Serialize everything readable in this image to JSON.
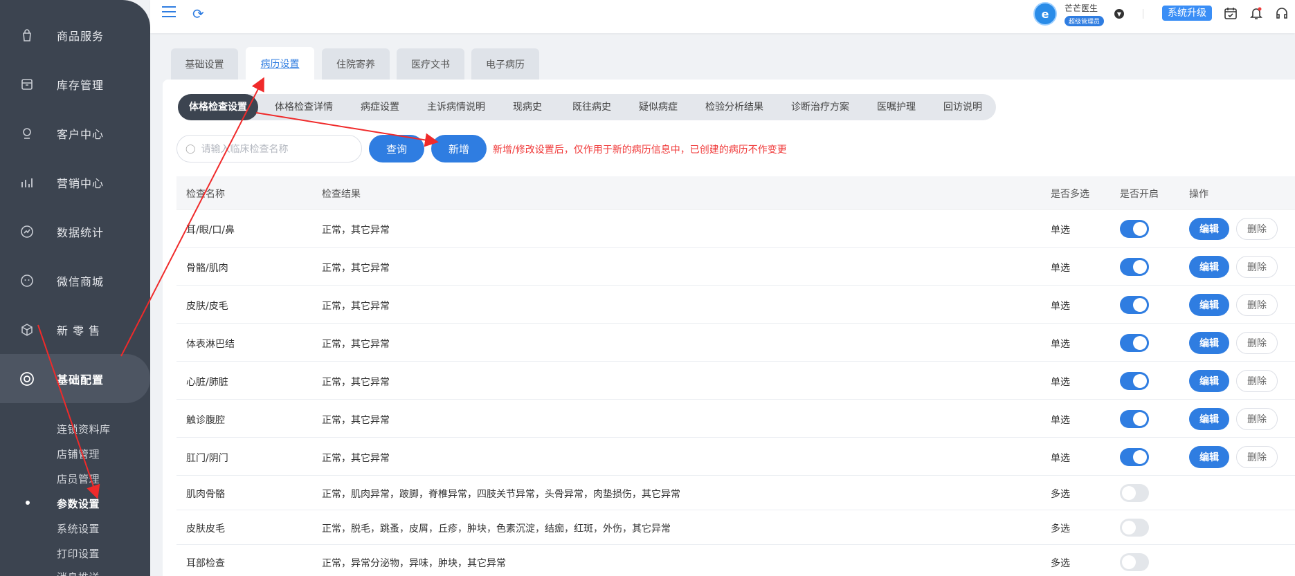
{
  "sidebar": {
    "items": [
      {
        "label": "商品服务",
        "icon": "bag-icon"
      },
      {
        "label": "库存管理",
        "icon": "box-icon"
      },
      {
        "label": "客户中心",
        "icon": "user-icon"
      },
      {
        "label": "营销中心",
        "icon": "chart-icon"
      },
      {
        "label": "数据统计",
        "icon": "stats-icon"
      },
      {
        "label": "微信商城",
        "icon": "wechat-icon"
      },
      {
        "label": "新 零 售",
        "icon": "cube-icon"
      },
      {
        "label": "基础配置",
        "icon": "target-icon"
      }
    ],
    "sub_items": [
      "连锁资料库",
      "店铺管理",
      "店员管理",
      "参数设置",
      "系统设置",
      "打印设置",
      "消息推送"
    ]
  },
  "header": {
    "user_name": "芒芒医生",
    "user_role": "超级管理员",
    "avatar_text": "e",
    "upgrade_label": "系统升级"
  },
  "top_tabs": [
    "基础设置",
    "病历设置",
    "住院寄养",
    "医疗文书",
    "电子病历"
  ],
  "sub_tabs": [
    "体格检查设置",
    "体格检查详情",
    "病症设置",
    "主诉病情说明",
    "现病史",
    "既往病史",
    "疑似病症",
    "检验分析结果",
    "诊断治疗方案",
    "医嘱护理",
    "回访说明"
  ],
  "search": {
    "placeholder": "请输入临床检查名称"
  },
  "buttons": {
    "query": "查询",
    "add": "新增",
    "edit": "编辑",
    "delete": "删除"
  },
  "notice": "新增/修改设置后，仅作用于新的病历信息中，已创建的病历不作变更",
  "table": {
    "headers": [
      "检查名称",
      "检查结果",
      "是否多选",
      "是否开启",
      "操作"
    ],
    "rows": [
      {
        "name": "耳/眼/口/鼻",
        "result": "正常，其它异常",
        "multi": "单选",
        "enabled": true,
        "actions": true
      },
      {
        "name": "骨骼/肌肉",
        "result": "正常，其它异常",
        "multi": "单选",
        "enabled": true,
        "actions": true
      },
      {
        "name": "皮肤/皮毛",
        "result": "正常，其它异常",
        "multi": "单选",
        "enabled": true,
        "actions": true
      },
      {
        "name": "体表淋巴结",
        "result": "正常，其它异常",
        "multi": "单选",
        "enabled": true,
        "actions": true
      },
      {
        "name": "心脏/肺脏",
        "result": "正常，其它异常",
        "multi": "单选",
        "enabled": true,
        "actions": true
      },
      {
        "name": "触诊腹腔",
        "result": "正常，其它异常",
        "multi": "单选",
        "enabled": true,
        "actions": true
      },
      {
        "name": "肛门/阴门",
        "result": "正常，其它异常",
        "multi": "单选",
        "enabled": true,
        "actions": true
      },
      {
        "name": "肌肉骨骼",
        "result": "正常，肌肉异常，跛脚，脊椎异常，四肢关节异常，头骨异常，肉垫损伤，其它异常",
        "multi": "多选",
        "enabled": false,
        "actions": false
      },
      {
        "name": "皮肤皮毛",
        "result": "正常，脱毛，跳蚤，皮屑，丘疹，肿块，色素沉淀，结痂，红斑，外伤，其它异常",
        "multi": "多选",
        "enabled": false,
        "actions": false
      },
      {
        "name": "耳部检查",
        "result": "正常，异常分泌物，异味，肿块，其它异常",
        "multi": "多选",
        "enabled": false,
        "actions": false
      }
    ]
  },
  "colors": {
    "accent": "#2f7de1",
    "sidebar": "#3c4450",
    "warning": "#f03a3a",
    "annotation": "#f02a2a"
  }
}
